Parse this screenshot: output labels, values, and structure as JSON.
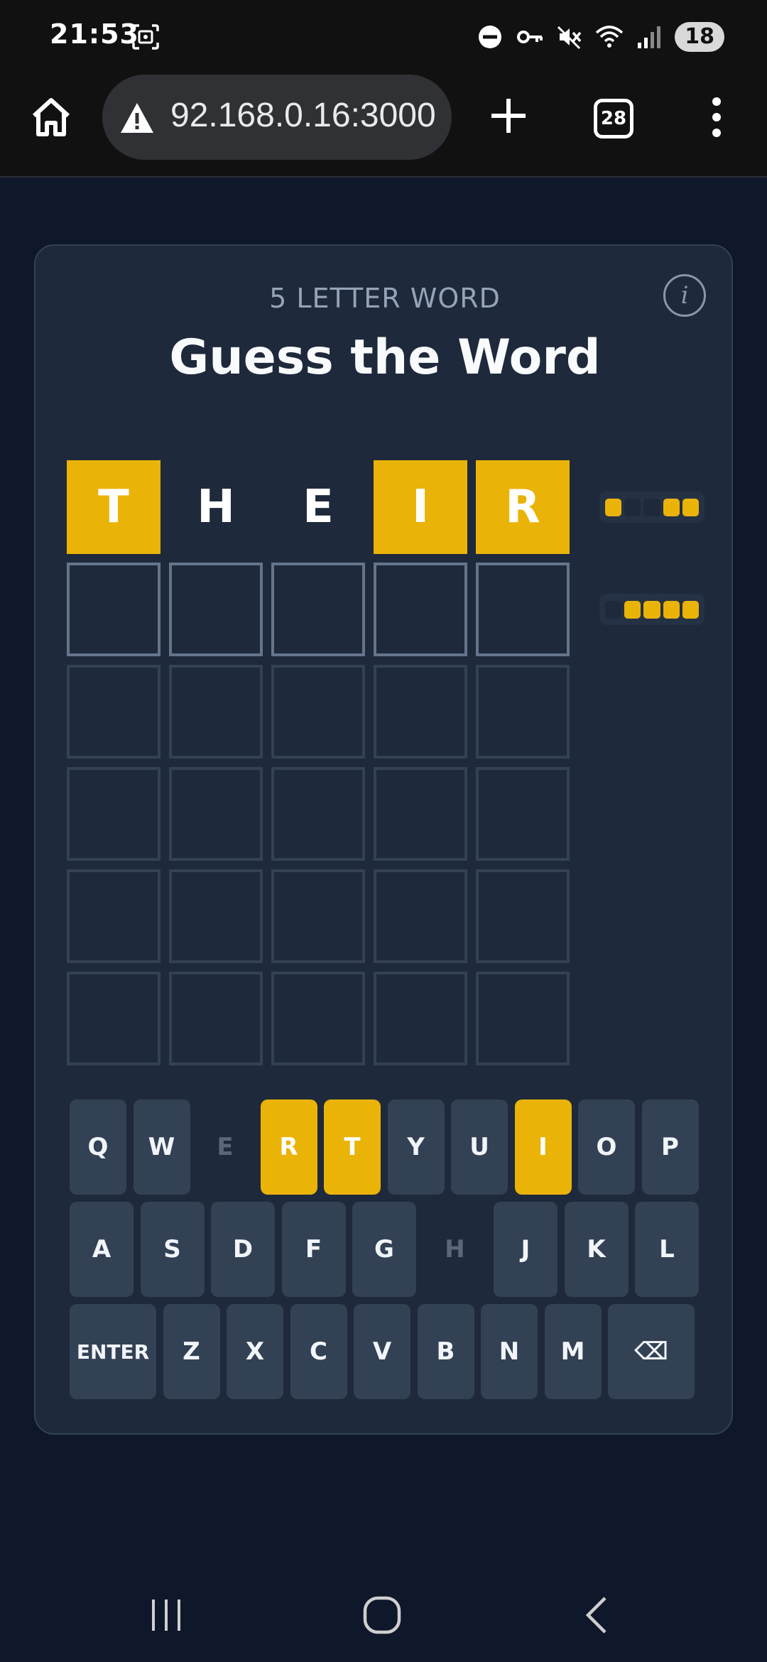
{
  "status_bar": {
    "time": "21:53",
    "battery": "18"
  },
  "browser": {
    "url": "92.168.0.16:3000",
    "tab_count": "28"
  },
  "game": {
    "subtitle": "5 LETTER WORD",
    "title": "Guess the Word",
    "info_label": "i",
    "rows": [
      {
        "tiles": [
          {
            "letter": "T",
            "state": "present"
          },
          {
            "letter": "H",
            "state": "absent"
          },
          {
            "letter": "E",
            "state": "absent"
          },
          {
            "letter": "I",
            "state": "present"
          },
          {
            "letter": "R",
            "state": "present"
          }
        ],
        "hint_dots": [
          true,
          false,
          false,
          true,
          true
        ]
      },
      {
        "tiles": [
          {
            "letter": "",
            "state": "active"
          },
          {
            "letter": "",
            "state": "active"
          },
          {
            "letter": "",
            "state": "active"
          },
          {
            "letter": "",
            "state": "active"
          },
          {
            "letter": "",
            "state": "active"
          }
        ],
        "hint_dots": [
          false,
          true,
          true,
          true,
          true
        ]
      },
      {
        "tiles": [
          {
            "letter": "",
            "state": "empty"
          },
          {
            "letter": "",
            "state": "empty"
          },
          {
            "letter": "",
            "state": "empty"
          },
          {
            "letter": "",
            "state": "empty"
          },
          {
            "letter": "",
            "state": "empty"
          }
        ]
      },
      {
        "tiles": [
          {
            "letter": "",
            "state": "empty"
          },
          {
            "letter": "",
            "state": "empty"
          },
          {
            "letter": "",
            "state": "empty"
          },
          {
            "letter": "",
            "state": "empty"
          },
          {
            "letter": "",
            "state": "empty"
          }
        ]
      },
      {
        "tiles": [
          {
            "letter": "",
            "state": "empty"
          },
          {
            "letter": "",
            "state": "empty"
          },
          {
            "letter": "",
            "state": "empty"
          },
          {
            "letter": "",
            "state": "empty"
          },
          {
            "letter": "",
            "state": "empty"
          }
        ]
      },
      {
        "tiles": [
          {
            "letter": "",
            "state": "empty"
          },
          {
            "letter": "",
            "state": "empty"
          },
          {
            "letter": "",
            "state": "empty"
          },
          {
            "letter": "",
            "state": "empty"
          },
          {
            "letter": "",
            "state": "empty"
          }
        ]
      }
    ]
  },
  "keyboard": {
    "rows": [
      [
        {
          "label": "Q",
          "state": "unused"
        },
        {
          "label": "W",
          "state": "unused"
        },
        {
          "label": "E",
          "state": "used"
        },
        {
          "label": "R",
          "state": "present"
        },
        {
          "label": "T",
          "state": "present"
        },
        {
          "label": "Y",
          "state": "unused"
        },
        {
          "label": "U",
          "state": "unused"
        },
        {
          "label": "I",
          "state": "present"
        },
        {
          "label": "O",
          "state": "unused"
        },
        {
          "label": "P",
          "state": "unused"
        }
      ],
      [
        {
          "label": "A",
          "state": "unused"
        },
        {
          "label": "S",
          "state": "unused"
        },
        {
          "label": "D",
          "state": "unused"
        },
        {
          "label": "F",
          "state": "unused"
        },
        {
          "label": "G",
          "state": "unused"
        },
        {
          "label": "H",
          "state": "used"
        },
        {
          "label": "J",
          "state": "unused"
        },
        {
          "label": "K",
          "state": "unused"
        },
        {
          "label": "L",
          "state": "unused"
        }
      ],
      [
        {
          "label": "ENTER",
          "state": "unused"
        },
        {
          "label": "Z",
          "state": "unused"
        },
        {
          "label": "X",
          "state": "unused"
        },
        {
          "label": "C",
          "state": "unused"
        },
        {
          "label": "V",
          "state": "unused"
        },
        {
          "label": "B",
          "state": "unused"
        },
        {
          "label": "N",
          "state": "unused"
        },
        {
          "label": "M",
          "state": "unused"
        },
        {
          "label": "⌫",
          "state": "unused"
        }
      ]
    ]
  },
  "colors": {
    "present": "#eab308",
    "background": "#0f172a",
    "card": "#1e293b",
    "key": "#334155"
  },
  "icons": {
    "home": "home-icon",
    "warning": "warning-icon",
    "new_tab": "plus-icon",
    "menu": "more-vert-icon",
    "backspace": "backspace-icon",
    "nav_recents": "recents-icon",
    "nav_home": "nav-home-icon",
    "nav_back": "back-icon"
  }
}
